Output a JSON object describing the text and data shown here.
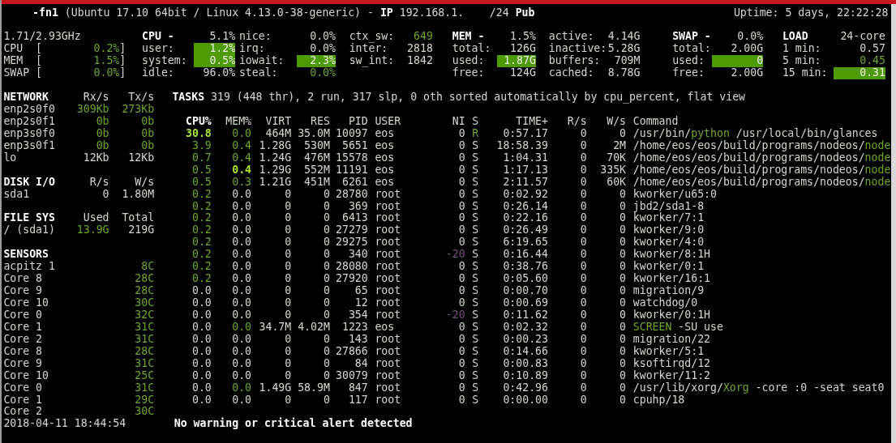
{
  "header": {
    "hostname": "-fn1",
    "system": "(Ubuntu 17.10 64bit / Linux 4.13.0-38-generic)",
    "separator": "-",
    "ip_label": "IP",
    "ip": "192.168.1.",
    "mask": "/24",
    "public_label": "Pub",
    "uptime": "Uptime: 5 days, 22:22:28"
  },
  "quicklook": {
    "frequency": "1.71/2.93GHz",
    "bars": [
      {
        "label": "CPU",
        "open": "[",
        "value": "0.2%",
        "close": "]",
        "ok": true
      },
      {
        "label": "MEM",
        "open": "[",
        "value": "1.5%",
        "close": "]",
        "ok": true
      },
      {
        "label": "SWAP",
        "open": "[",
        "value": "0.0%",
        "close": "]",
        "ok": true
      }
    ]
  },
  "stats": [
    {
      "rows": [
        {
          "kind": "heading",
          "label": "CPU -",
          "value": "5.1%",
          "ok": false,
          "highlighted": false
        },
        {
          "kind": "stat",
          "label": "user:",
          "value": "1.2%",
          "ok": false,
          "highlighted": true
        },
        {
          "kind": "stat",
          "label": "system:",
          "value": "0.5%",
          "ok": false,
          "highlighted": true
        },
        {
          "kind": "stat",
          "label": "idle:",
          "value": "96.0%",
          "ok": false,
          "highlighted": false
        }
      ]
    },
    {
      "rows": [
        {
          "kind": "stat",
          "label": "nice:",
          "value": "0.0%",
          "ok": false,
          "highlighted": false
        },
        {
          "kind": "stat",
          "label": "irq:",
          "value": "0.0%",
          "ok": false,
          "highlighted": false
        },
        {
          "kind": "stat",
          "label": "iowait:",
          "value": "2.3%",
          "ok": false,
          "highlighted": true
        },
        {
          "kind": "stat",
          "label": "steal:",
          "value": "0.0%",
          "ok": true,
          "highlighted": false
        }
      ]
    },
    {
      "rows": [
        {
          "kind": "stat",
          "label": "ctx_sw:",
          "value": "649",
          "ok": true,
          "highlighted": false
        },
        {
          "kind": "stat",
          "label": "inter:",
          "value": "2818",
          "ok": false,
          "highlighted": false
        },
        {
          "kind": "stat",
          "label": "sw_int:",
          "value": "1842",
          "ok": false,
          "highlighted": false
        }
      ]
    },
    {
      "rows": [
        {
          "kind": "heading",
          "label": "MEM -",
          "value": "1.5%",
          "ok": false,
          "highlighted": false
        },
        {
          "kind": "stat",
          "label": "total:",
          "value": "126G",
          "ok": false,
          "highlighted": false
        },
        {
          "kind": "stat",
          "label": "used:",
          "value": "1.87G",
          "ok": false,
          "highlighted": true
        },
        {
          "kind": "stat",
          "label": "free:",
          "value": "124G",
          "ok": false,
          "highlighted": false
        }
      ]
    },
    {
      "rows": [
        {
          "kind": "stat",
          "label": "active:",
          "value": "4.14G",
          "ok": false,
          "highlighted": false
        },
        {
          "kind": "stat",
          "label": "inactive:",
          "value": "5.28G",
          "ok": false,
          "highlighted": false
        },
        {
          "kind": "stat",
          "label": "buffers:",
          "value": "709M",
          "ok": false,
          "highlighted": false
        },
        {
          "kind": "stat",
          "label": "cached:",
          "value": "8.78G",
          "ok": false,
          "highlighted": false
        }
      ]
    },
    {
      "rows": [
        {
          "kind": "heading",
          "label": "SWAP -",
          "value": "0.0%",
          "ok": false,
          "highlighted": false
        },
        {
          "kind": "stat",
          "label": "total:",
          "value": "2.00G",
          "ok": false,
          "highlighted": false
        },
        {
          "kind": "stat",
          "label": "used:",
          "value": "0",
          "ok": false,
          "highlighted": true
        },
        {
          "kind": "stat",
          "label": "free:",
          "value": "2.00G",
          "ok": false,
          "highlighted": false
        }
      ]
    },
    {
      "rows": [
        {
          "kind": "heading",
          "label": "LOAD",
          "value": "24-core",
          "ok": false,
          "highlighted": false
        },
        {
          "kind": "stat",
          "label": "1 min:",
          "value": "0.57",
          "ok": false,
          "highlighted": false
        },
        {
          "kind": "stat",
          "label": "5 min:",
          "value": "0.45",
          "ok": true,
          "highlighted": false
        },
        {
          "kind": "stat",
          "label": "15 min:",
          "value": "0.31",
          "ok": false,
          "highlighted": true
        }
      ]
    }
  ],
  "sections": [
    {
      "kind": "rates",
      "columns": [
        "NETWORK",
        "Rx/s",
        "Tx/s"
      ],
      "rows": [
        {
          "cells": [
            {
              "text": "enp2s0f0",
              "ok": false
            },
            {
              "text": "309Kb",
              "ok": true
            },
            {
              "text": "273Kb",
              "ok": true
            }
          ]
        },
        {
          "cells": [
            {
              "text": "enp2s0f1",
              "ok": false
            },
            {
              "text": "0b",
              "ok": true
            },
            {
              "text": "0b",
              "ok": true
            }
          ]
        },
        {
          "cells": [
            {
              "text": "enp3s0f0",
              "ok": false
            },
            {
              "text": "0b",
              "ok": true
            },
            {
              "text": "0b",
              "ok": true
            }
          ]
        },
        {
          "cells": [
            {
              "text": "enp3s0f1",
              "ok": false
            },
            {
              "text": "0b",
              "ok": true
            },
            {
              "text": "0b",
              "ok": true
            }
          ]
        },
        {
          "cells": [
            {
              "text": "lo",
              "ok": false
            },
            {
              "text": "12Kb",
              "ok": false
            },
            {
              "text": "12Kb",
              "ok": false
            }
          ]
        }
      ]
    },
    {
      "kind": "rates",
      "columns": [
        "DISK I/O",
        "R/s",
        "W/s"
      ],
      "rows": [
        {
          "cells": [
            {
              "text": "sda1",
              "ok": false
            },
            {
              "text": "0",
              "ok": false
            },
            {
              "text": "1.80M",
              "ok": false
            }
          ]
        }
      ]
    },
    {
      "kind": "rates",
      "columns": [
        "FILE SYS",
        "Used",
        "Total"
      ],
      "rows": [
        {
          "cells": [
            {
              "text": "/ (sda1)",
              "ok": false
            },
            {
              "text": "13.9G",
              "ok": true
            },
            {
              "text": "219G",
              "ok": false
            }
          ]
        }
      ]
    },
    {
      "kind": "sensors",
      "columns": [
        "SENSORS"
      ],
      "rows": [
        {
          "cells": [
            {
              "text": "acpitz 1",
              "ok": false
            },
            {
              "text": "8C",
              "ok": true
            }
          ]
        },
        {
          "cells": [
            {
              "text": "Core 8",
              "ok": false
            },
            {
              "text": "28C",
              "ok": true
            }
          ]
        },
        {
          "cells": [
            {
              "text": "Core 9",
              "ok": false
            },
            {
              "text": "28C",
              "ok": true
            }
          ]
        },
        {
          "cells": [
            {
              "text": "Core 10",
              "ok": false
            },
            {
              "text": "30C",
              "ok": true
            }
          ]
        },
        {
          "cells": [
            {
              "text": "Core 0",
              "ok": false
            },
            {
              "text": "32C",
              "ok": true
            }
          ]
        },
        {
          "cells": [
            {
              "text": "Core 1",
              "ok": false
            },
            {
              "text": "31C",
              "ok": true
            }
          ]
        },
        {
          "cells": [
            {
              "text": "Core 2",
              "ok": false
            },
            {
              "text": "31C",
              "ok": true
            }
          ]
        },
        {
          "cells": [
            {
              "text": "Core 8",
              "ok": false
            },
            {
              "text": "28C",
              "ok": true
            }
          ]
        },
        {
          "cells": [
            {
              "text": "Core 9",
              "ok": false
            },
            {
              "text": "31C",
              "ok": true
            }
          ]
        },
        {
          "cells": [
            {
              "text": "Core 10",
              "ok": false
            },
            {
              "text": "25C",
              "ok": true
            }
          ]
        },
        {
          "cells": [
            {
              "text": "Core 0",
              "ok": false
            },
            {
              "text": "31C",
              "ok": true
            }
          ]
        },
        {
          "cells": [
            {
              "text": "Core 1",
              "ok": false
            },
            {
              "text": "29C",
              "ok": true
            }
          ]
        },
        {
          "cells": [
            {
              "text": "Core 2",
              "ok": false
            },
            {
              "text": "30C",
              "ok": true
            }
          ]
        }
      ]
    }
  ],
  "tasks": "**TASKS** 319 (448 thr), 2 run, 317 slp, 0 oth sorted automatically by cpu_percent, flat view",
  "process_columns": [
    {
      "label": "CPU%",
      "sorted": true
    },
    {
      "label": "MEM%",
      "sorted": false
    },
    {
      "label": "VIRT",
      "sorted": false
    },
    {
      "label": "RES",
      "sorted": false
    },
    {
      "label": "PID",
      "sorted": false
    },
    {
      "label": "USER",
      "sorted": false
    },
    {
      "label": "NI",
      "sorted": false
    },
    {
      "label": "S",
      "sorted": false
    },
    {
      "label": "TIME+",
      "sorted": false
    },
    {
      "label": "R/s",
      "sorted": false
    },
    {
      "label": "W/s",
      "sorted": false
    },
    {
      "label": "Command",
      "sorted": false
    }
  ],
  "processes": [
    {
      "cpu": "30.8",
      "cpu_ok": true,
      "cpu_top": true,
      "mem": "0.0",
      "mem_ok": true,
      "mem_top": false,
      "virt": "464M",
      "res": "35.0M",
      "pid": "10097",
      "user": "eos",
      "ni": "0",
      "niced": false,
      "s": "R",
      "running": true,
      "time": "0:57.17",
      "rs": "0",
      "ws": "0",
      "command": [
        {
          "text": "/usr/bin/",
          "ok": false
        },
        {
          "text": "python",
          "ok": true
        },
        {
          "text": " /usr/local/bin/glances",
          "ok": false
        }
      ]
    },
    {
      "cpu": "3.9",
      "cpu_ok": true,
      "cpu_top": false,
      "mem": "0.4",
      "mem_ok": true,
      "mem_top": false,
      "virt": "1.28G",
      "res": "530M",
      "pid": "5651",
      "user": "eos",
      "ni": "0",
      "niced": false,
      "s": "S",
      "running": false,
      "time": "18:58.39",
      "rs": "0",
      "ws": "2M",
      "command": [
        {
          "text": "/home/eos/eos/build/programs/nodeos/",
          "ok": false
        },
        {
          "text": "node",
          "ok": true
        }
      ]
    },
    {
      "cpu": "0.7",
      "cpu_ok": true,
      "cpu_top": false,
      "mem": "0.4",
      "mem_ok": true,
      "mem_top": false,
      "virt": "1.24G",
      "res": "476M",
      "pid": "15578",
      "user": "eos",
      "ni": "0",
      "niced": false,
      "s": "S",
      "running": false,
      "time": "1:04.31",
      "rs": "0",
      "ws": "70K",
      "command": [
        {
          "text": "/home/eos/eos/build/programs/nodeos/",
          "ok": false
        },
        {
          "text": "node",
          "ok": true
        }
      ]
    },
    {
      "cpu": "0.5",
      "cpu_ok": true,
      "cpu_top": false,
      "mem": "0.4",
      "mem_ok": true,
      "mem_top": true,
      "virt": "1.29G",
      "res": "552M",
      "pid": "11191",
      "user": "eos",
      "ni": "0",
      "niced": false,
      "s": "S",
      "running": false,
      "time": "1:17.13",
      "rs": "0",
      "ws": "335K",
      "command": [
        {
          "text": "/home/eos/eos/build/programs/nodeos/",
          "ok": false
        },
        {
          "text": "node",
          "ok": true
        }
      ]
    },
    {
      "cpu": "0.5",
      "cpu_ok": true,
      "cpu_top": false,
      "mem": "0.3",
      "mem_ok": true,
      "mem_top": false,
      "virt": "1.21G",
      "res": "451M",
      "pid": "6261",
      "user": "eos",
      "ni": "0",
      "niced": false,
      "s": "S",
      "running": false,
      "time": "2:11.57",
      "rs": "0",
      "ws": "60K",
      "command": [
        {
          "text": "/home/eos/eos/build/programs/nodeos/",
          "ok": false
        },
        {
          "text": "node",
          "ok": true
        }
      ]
    },
    {
      "cpu": "0.2",
      "cpu_ok": true,
      "cpu_top": false,
      "mem": "0.0",
      "mem_ok": false,
      "mem_top": false,
      "virt": "0",
      "res": "0",
      "pid": "28780",
      "user": "root",
      "ni": "0",
      "niced": false,
      "s": "S",
      "running": false,
      "time": "0:02.92",
      "rs": "0",
      "ws": "0",
      "command": [
        {
          "text": "kworker/u65:0",
          "ok": false
        }
      ]
    },
    {
      "cpu": "0.2",
      "cpu_ok": true,
      "cpu_top": false,
      "mem": "0.0",
      "mem_ok": false,
      "mem_top": false,
      "virt": "0",
      "res": "0",
      "pid": "369",
      "user": "root",
      "ni": "0",
      "niced": false,
      "s": "S",
      "running": false,
      "time": "0:26.14",
      "rs": "0",
      "ws": "0",
      "command": [
        {
          "text": "jbd2/sda1-8",
          "ok": false
        }
      ]
    },
    {
      "cpu": "0.2",
      "cpu_ok": true,
      "cpu_top": false,
      "mem": "0.0",
      "mem_ok": false,
      "mem_top": false,
      "virt": "0",
      "res": "0",
      "pid": "6413",
      "user": "root",
      "ni": "0",
      "niced": false,
      "s": "S",
      "running": false,
      "time": "0:22.16",
      "rs": "0",
      "ws": "0",
      "command": [
        {
          "text": "kworker/7:1",
          "ok": false
        }
      ]
    },
    {
      "cpu": "0.2",
      "cpu_ok": true,
      "cpu_top": false,
      "mem": "0.0",
      "mem_ok": false,
      "mem_top": false,
      "virt": "0",
      "res": "0",
      "pid": "27279",
      "user": "root",
      "ni": "0",
      "niced": false,
      "s": "S",
      "running": false,
      "time": "0:26.49",
      "rs": "0",
      "ws": "0",
      "command": [
        {
          "text": "kworker/9:0",
          "ok": false
        }
      ]
    },
    {
      "cpu": "0.2",
      "cpu_ok": true,
      "cpu_top": false,
      "mem": "0.0",
      "mem_ok": false,
      "mem_top": false,
      "virt": "0",
      "res": "0",
      "pid": "29275",
      "user": "root",
      "ni": "0",
      "niced": false,
      "s": "S",
      "running": false,
      "time": "6:19.65",
      "rs": "0",
      "ws": "0",
      "command": [
        {
          "text": "kworker/4:0",
          "ok": false
        }
      ]
    },
    {
      "cpu": "0.2",
      "cpu_ok": true,
      "cpu_top": false,
      "mem": "0.0",
      "mem_ok": false,
      "mem_top": false,
      "virt": "0",
      "res": "0",
      "pid": "340",
      "user": "root",
      "ni": "-20",
      "niced": true,
      "s": "S",
      "running": false,
      "time": "0:16.44",
      "rs": "0",
      "ws": "0",
      "command": [
        {
          "text": "kworker/8:1H",
          "ok": false
        }
      ]
    },
    {
      "cpu": "0.2",
      "cpu_ok": true,
      "cpu_top": false,
      "mem": "0.0",
      "mem_ok": false,
      "mem_top": false,
      "virt": "0",
      "res": "0",
      "pid": "28080",
      "user": "root",
      "ni": "0",
      "niced": false,
      "s": "S",
      "running": false,
      "time": "0:38.76",
      "rs": "0",
      "ws": "0",
      "command": [
        {
          "text": "kworker/0:1",
          "ok": false
        }
      ]
    },
    {
      "cpu": "0.2",
      "cpu_ok": true,
      "cpu_top": false,
      "mem": "0.0",
      "mem_ok": false,
      "mem_top": false,
      "virt": "0",
      "res": "0",
      "pid": "27920",
      "user": "root",
      "ni": "0",
      "niced": false,
      "s": "S",
      "running": false,
      "time": "0:05.60",
      "rs": "0",
      "ws": "0",
      "command": [
        {
          "text": "kworker/16:1",
          "ok": false
        }
      ]
    },
    {
      "cpu": "0.0",
      "cpu_ok": false,
      "cpu_top": false,
      "mem": "0.0",
      "mem_ok": false,
      "mem_top": false,
      "virt": "0",
      "res": "0",
      "pid": "65",
      "user": "root",
      "ni": "0",
      "niced": false,
      "s": "S",
      "running": false,
      "time": "0:00.70",
      "rs": "0",
      "ws": "0",
      "command": [
        {
          "text": "migration/9",
          "ok": false
        }
      ]
    },
    {
      "cpu": "0.0",
      "cpu_ok": false,
      "cpu_top": false,
      "mem": "0.0",
      "mem_ok": false,
      "mem_top": false,
      "virt": "0",
      "res": "0",
      "pid": "12",
      "user": "root",
      "ni": "0",
      "niced": false,
      "s": "S",
      "running": false,
      "time": "0:00.69",
      "rs": "0",
      "ws": "0",
      "command": [
        {
          "text": "watchdog/0",
          "ok": false
        }
      ]
    },
    {
      "cpu": "0.0",
      "cpu_ok": false,
      "cpu_top": false,
      "mem": "0.0",
      "mem_ok": false,
      "mem_top": false,
      "virt": "0",
      "res": "0",
      "pid": "354",
      "user": "root",
      "ni": "-20",
      "niced": true,
      "s": "S",
      "running": false,
      "time": "0:11.62",
      "rs": "0",
      "ws": "0",
      "command": [
        {
          "text": "kworker/0:1H",
          "ok": false
        }
      ]
    },
    {
      "cpu": "0.0",
      "cpu_ok": false,
      "cpu_top": false,
      "mem": "0.0",
      "mem_ok": true,
      "mem_top": false,
      "virt": "34.7M",
      "res": "4.02M",
      "pid": "1223",
      "user": "eos",
      "ni": "0",
      "niced": false,
      "s": "S",
      "running": false,
      "time": "0:02.32",
      "rs": "0",
      "ws": "0",
      "command": [
        {
          "text": "SCREEN",
          "ok": true
        },
        {
          "text": " -SU use",
          "ok": false
        }
      ]
    },
    {
      "cpu": "0.0",
      "cpu_ok": false,
      "cpu_top": false,
      "mem": "0.0",
      "mem_ok": false,
      "mem_top": false,
      "virt": "0",
      "res": "0",
      "pid": "143",
      "user": "root",
      "ni": "0",
      "niced": false,
      "s": "S",
      "running": false,
      "time": "0:00.23",
      "rs": "0",
      "ws": "0",
      "command": [
        {
          "text": "migration/22",
          "ok": false
        }
      ]
    },
    {
      "cpu": "0.0",
      "cpu_ok": false,
      "cpu_top": false,
      "mem": "0.0",
      "mem_ok": false,
      "mem_top": false,
      "virt": "0",
      "res": "0",
      "pid": "27866",
      "user": "root",
      "ni": "0",
      "niced": false,
      "s": "S",
      "running": false,
      "time": "0:14.66",
      "rs": "0",
      "ws": "0",
      "command": [
        {
          "text": "kworker/5:1",
          "ok": false
        }
      ]
    },
    {
      "cpu": "0.0",
      "cpu_ok": false,
      "cpu_top": false,
      "mem": "0.0",
      "mem_ok": false,
      "mem_top": false,
      "virt": "0",
      "res": "0",
      "pid": "84",
      "user": "root",
      "ni": "0",
      "niced": false,
      "s": "S",
      "running": false,
      "time": "0:00.83",
      "rs": "0",
      "ws": "0",
      "command": [
        {
          "text": "ksoftirqd/12",
          "ok": false
        }
      ]
    },
    {
      "cpu": "0.0",
      "cpu_ok": false,
      "cpu_top": false,
      "mem": "0.0",
      "mem_ok": false,
      "mem_top": false,
      "virt": "0",
      "res": "0",
      "pid": "30079",
      "user": "root",
      "ni": "0",
      "niced": false,
      "s": "S",
      "running": false,
      "time": "0:10.89",
      "rs": "0",
      "ws": "0",
      "command": [
        {
          "text": "kworker/11:2",
          "ok": false
        }
      ]
    },
    {
      "cpu": "0.0",
      "cpu_ok": false,
      "cpu_top": false,
      "mem": "0.0",
      "mem_ok": true,
      "mem_top": false,
      "virt": "1.49G",
      "res": "58.9M",
      "pid": "847",
      "user": "root",
      "ni": "0",
      "niced": false,
      "s": "S",
      "running": false,
      "time": "0:42.96",
      "rs": "0",
      "ws": "0",
      "command": [
        {
          "text": "/usr/lib/xorg/",
          "ok": false
        },
        {
          "text": "Xorg",
          "ok": true
        },
        {
          "text": " -core :0 -seat seat0",
          "ok": false
        }
      ]
    },
    {
      "cpu": "0.0",
      "cpu_ok": false,
      "cpu_top": false,
      "mem": "0.0",
      "mem_ok": false,
      "mem_top": false,
      "virt": "0",
      "res": "0",
      "pid": "117",
      "user": "root",
      "ni": "0",
      "niced": false,
      "s": "S",
      "running": false,
      "time": "0:00.00",
      "rs": "0",
      "ws": "0",
      "command": [
        {
          "text": "cpuhp/18",
          "ok": false
        }
      ]
    }
  ],
  "footer": {
    "datetime": "2018-04-11 18:44:54",
    "alert": "No warning or critical alert detected"
  }
}
